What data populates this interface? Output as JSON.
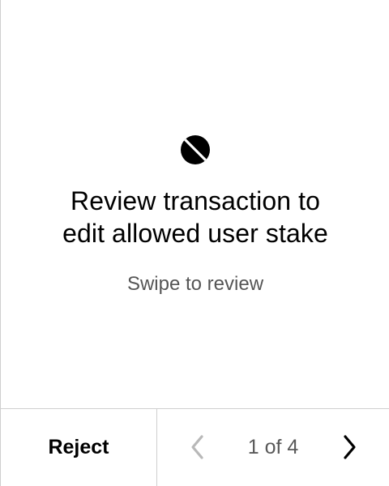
{
  "icons": {
    "app": "app-symbol-icon",
    "previous": "chevron-left-icon",
    "next": "chevron-right-icon"
  },
  "review": {
    "title_line1": "Review transaction to",
    "title_line2": "edit allowed user stake",
    "subtitle": "Swipe to review"
  },
  "footer": {
    "reject_label": "Reject",
    "page_indicator": "1 of 4"
  },
  "colors": {
    "text": "#000000",
    "muted_text": "#555555",
    "disabled_icon": "#b8b8b8",
    "divider": "#cfcfcf"
  }
}
